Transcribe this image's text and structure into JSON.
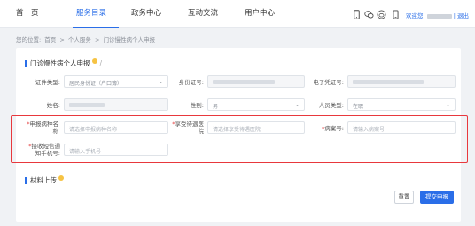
{
  "nav": {
    "items": [
      "首　页",
      "服务目录",
      "政务中心",
      "互动交流",
      "用户中心"
    ],
    "welcome_prefix": "欢迎您:",
    "logout": "| 退出",
    "icons": [
      "mobile-icon",
      "wechat-icon",
      "weibo-icon",
      "phone-icon"
    ]
  },
  "breadcrumb": [
    "您的位置:",
    "首页",
    ">",
    "个人服务",
    ">",
    "门诊慢性病个人申报"
  ],
  "form": {
    "title": "门诊慢性病个人申报",
    "title_slash": "/",
    "labels": {
      "cert_type": "证件类型:",
      "id_number": "身份证号:",
      "e_cert": "电子凭证号:",
      "name": "姓名:",
      "gender": "性别:",
      "person_type": "人员类型:",
      "disease": "申报病种名称",
      "hospital": "享受待遇医院",
      "case_no": "病案号:",
      "sms_phone": "接收短信通知手机号:"
    },
    "values": {
      "cert_type": "居民身份证（户口簿）",
      "gender": "男",
      "person_type": "在职"
    },
    "placeholders": {
      "disease": "请选择申报病种名称",
      "hospital": "请选择享受待遇医院",
      "case_no": "请输入病案号",
      "sms_phone": "请输入手机号"
    },
    "required_mark": "*"
  },
  "upload": {
    "title": "材料上传"
  },
  "buttons": {
    "reset": "重置",
    "submit": "提交申报"
  },
  "colors": {
    "accent": "#2a6ee8",
    "highlight": "#e8383d",
    "marker": "#f6c343"
  }
}
